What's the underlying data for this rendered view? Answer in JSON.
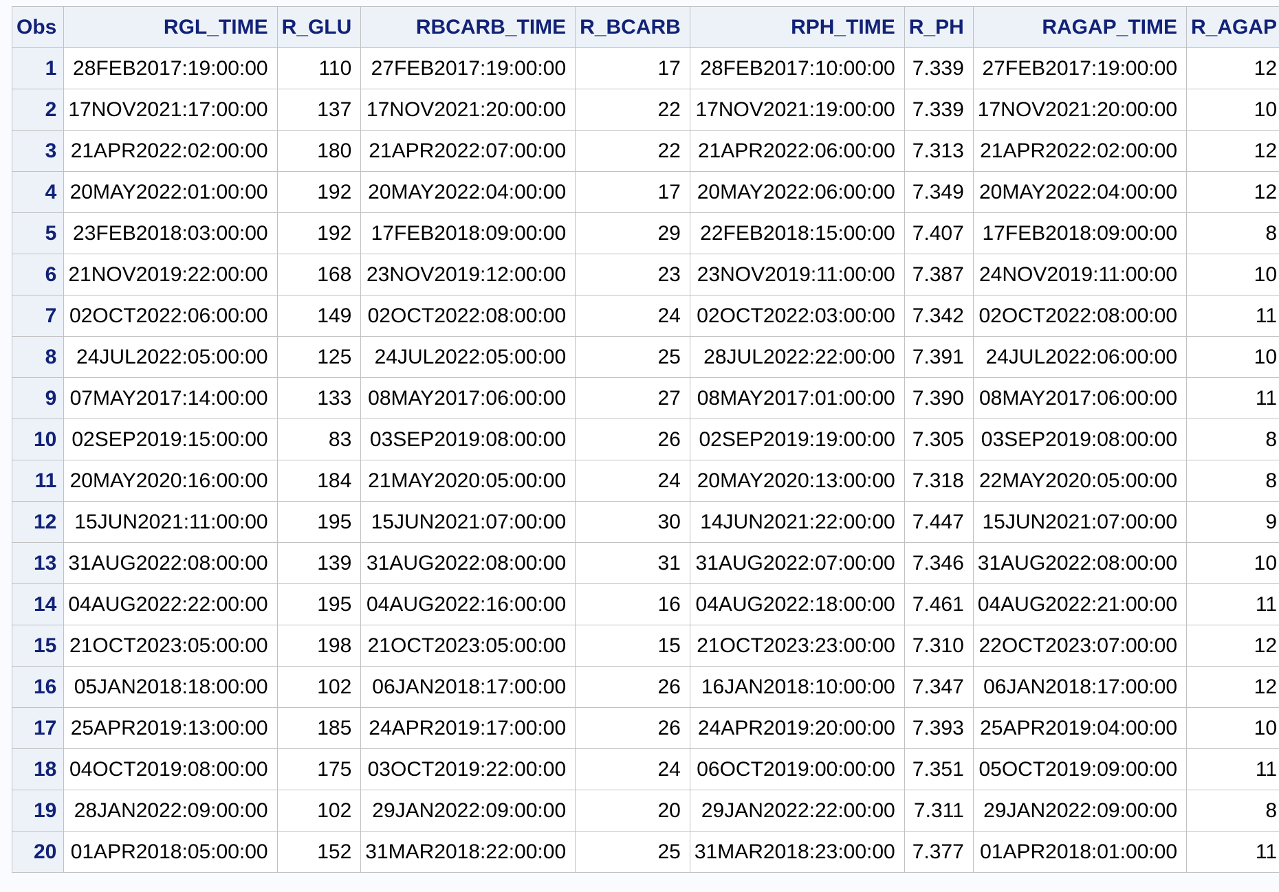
{
  "table": {
    "columns": [
      "Obs",
      "RGL_TIME",
      "R_GLU",
      "RBCARB_TIME",
      "R_BCARB",
      "RPH_TIME",
      "R_PH",
      "RAGAP_TIME",
      "R_AGAP"
    ],
    "rows": [
      [
        "1",
        "28FEB2017:19:00:00",
        "110",
        "27FEB2017:19:00:00",
        "17",
        "28FEB2017:10:00:00",
        "7.339",
        "27FEB2017:19:00:00",
        "12"
      ],
      [
        "2",
        "17NOV2021:17:00:00",
        "137",
        "17NOV2021:20:00:00",
        "22",
        "17NOV2021:19:00:00",
        "7.339",
        "17NOV2021:20:00:00",
        "10"
      ],
      [
        "3",
        "21APR2022:02:00:00",
        "180",
        "21APR2022:07:00:00",
        "22",
        "21APR2022:06:00:00",
        "7.313",
        "21APR2022:02:00:00",
        "12"
      ],
      [
        "4",
        "20MAY2022:01:00:00",
        "192",
        "20MAY2022:04:00:00",
        "17",
        "20MAY2022:06:00:00",
        "7.349",
        "20MAY2022:04:00:00",
        "12"
      ],
      [
        "5",
        "23FEB2018:03:00:00",
        "192",
        "17FEB2018:09:00:00",
        "29",
        "22FEB2018:15:00:00",
        "7.407",
        "17FEB2018:09:00:00",
        "8"
      ],
      [
        "6",
        "21NOV2019:22:00:00",
        "168",
        "23NOV2019:12:00:00",
        "23",
        "23NOV2019:11:00:00",
        "7.387",
        "24NOV2019:11:00:00",
        "10"
      ],
      [
        "7",
        "02OCT2022:06:00:00",
        "149",
        "02OCT2022:08:00:00",
        "24",
        "02OCT2022:03:00:00",
        "7.342",
        "02OCT2022:08:00:00",
        "11"
      ],
      [
        "8",
        "24JUL2022:05:00:00",
        "125",
        "24JUL2022:05:00:00",
        "25",
        "28JUL2022:22:00:00",
        "7.391",
        "24JUL2022:06:00:00",
        "10"
      ],
      [
        "9",
        "07MAY2017:14:00:00",
        "133",
        "08MAY2017:06:00:00",
        "27",
        "08MAY2017:01:00:00",
        "7.390",
        "08MAY2017:06:00:00",
        "11"
      ],
      [
        "10",
        "02SEP2019:15:00:00",
        "83",
        "03SEP2019:08:00:00",
        "26",
        "02SEP2019:19:00:00",
        "7.305",
        "03SEP2019:08:00:00",
        "8"
      ],
      [
        "11",
        "20MAY2020:16:00:00",
        "184",
        "21MAY2020:05:00:00",
        "24",
        "20MAY2020:13:00:00",
        "7.318",
        "22MAY2020:05:00:00",
        "8"
      ],
      [
        "12",
        "15JUN2021:11:00:00",
        "195",
        "15JUN2021:07:00:00",
        "30",
        "14JUN2021:22:00:00",
        "7.447",
        "15JUN2021:07:00:00",
        "9"
      ],
      [
        "13",
        "31AUG2022:08:00:00",
        "139",
        "31AUG2022:08:00:00",
        "31",
        "31AUG2022:07:00:00",
        "7.346",
        "31AUG2022:08:00:00",
        "10"
      ],
      [
        "14",
        "04AUG2022:22:00:00",
        "195",
        "04AUG2022:16:00:00",
        "16",
        "04AUG2022:18:00:00",
        "7.461",
        "04AUG2022:21:00:00",
        "11"
      ],
      [
        "15",
        "21OCT2023:05:00:00",
        "198",
        "21OCT2023:05:00:00",
        "15",
        "21OCT2023:23:00:00",
        "7.310",
        "22OCT2023:07:00:00",
        "12"
      ],
      [
        "16",
        "05JAN2018:18:00:00",
        "102",
        "06JAN2018:17:00:00",
        "26",
        "16JAN2018:10:00:00",
        "7.347",
        "06JAN2018:17:00:00",
        "12"
      ],
      [
        "17",
        "25APR2019:13:00:00",
        "185",
        "24APR2019:17:00:00",
        "26",
        "24APR2019:20:00:00",
        "7.393",
        "25APR2019:04:00:00",
        "10"
      ],
      [
        "18",
        "04OCT2019:08:00:00",
        "175",
        "03OCT2019:22:00:00",
        "24",
        "06OCT2019:00:00:00",
        "7.351",
        "05OCT2019:09:00:00",
        "11"
      ],
      [
        "19",
        "28JAN2022:09:00:00",
        "102",
        "29JAN2022:09:00:00",
        "20",
        "29JAN2022:22:00:00",
        "7.311",
        "29JAN2022:09:00:00",
        "8"
      ],
      [
        "20",
        "01APR2018:05:00:00",
        "152",
        "31MAR2018:22:00:00",
        "25",
        "31MAR2018:23:00:00",
        "7.377",
        "01APR2018:01:00:00",
        "11"
      ]
    ]
  }
}
